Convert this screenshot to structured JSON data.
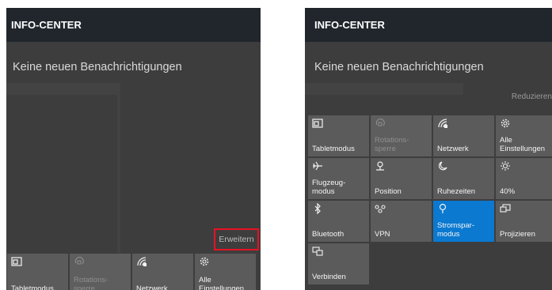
{
  "panels": {
    "left": {
      "title": "INFO-CENTER",
      "no_notifications": "Keine neuen Benachrichtigungen",
      "expand_label": "Erweitern",
      "tiles": [
        {
          "label": "Tabletmodus",
          "icon": "tablet-mode-icon",
          "state": "normal"
        },
        {
          "label": "Rotations-\nsperre",
          "icon": "rotation-lock-icon",
          "state": "disabled"
        },
        {
          "label": "Netzwerk",
          "icon": "network-icon",
          "state": "normal"
        },
        {
          "label": "Alle\nEinstellungen",
          "icon": "gear-icon",
          "state": "normal"
        }
      ]
    },
    "right": {
      "title": "INFO-CENTER",
      "no_notifications": "Keine neuen Benachrichtigungen",
      "collapse_label": "Reduzieren",
      "tiles": [
        {
          "label": "Tabletmodus",
          "icon": "tablet-mode-icon",
          "state": "normal"
        },
        {
          "label": "Rotations-\nsperre",
          "icon": "rotation-lock-icon",
          "state": "disabled"
        },
        {
          "label": "Netzwerk",
          "icon": "network-icon",
          "state": "normal"
        },
        {
          "label": "Alle\nEinstellungen",
          "icon": "gear-icon",
          "state": "normal"
        },
        {
          "label": "Flugzeug-\nmodus",
          "icon": "airplane-icon",
          "state": "normal"
        },
        {
          "label": "Position",
          "icon": "location-icon",
          "state": "normal"
        },
        {
          "label": "Ruhezeiten",
          "icon": "moon-icon",
          "state": "normal"
        },
        {
          "label": "40%",
          "icon": "brightness-icon",
          "state": "normal"
        },
        {
          "label": "Bluetooth",
          "icon": "bluetooth-icon",
          "state": "normal"
        },
        {
          "label": "VPN",
          "icon": "vpn-icon",
          "state": "normal"
        },
        {
          "label": "Stromspar-\nmodus",
          "icon": "battery-saver-icon",
          "state": "active"
        },
        {
          "label": "Projizieren",
          "icon": "project-icon",
          "state": "normal"
        },
        {
          "label": "Verbinden",
          "icon": "connect-icon",
          "state": "normal"
        }
      ]
    }
  },
  "colors": {
    "header_bg": "#21262d",
    "panel_bg": "#3d3d3d",
    "tile_bg": "#5b5b5b",
    "tile_active": "#0b79d0",
    "highlight_border": "#e81123"
  }
}
